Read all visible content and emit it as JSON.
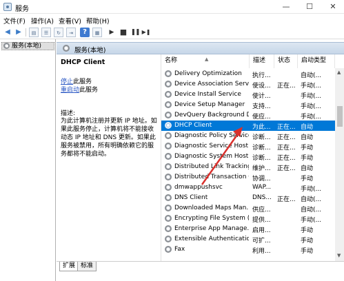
{
  "window": {
    "title": "服务",
    "min": "—",
    "max": "☐",
    "close": "✕"
  },
  "menu": [
    "文件(F)",
    "操作(A)",
    "查看(V)",
    "帮助(H)"
  ],
  "toolbar_icons": [
    "back-icon",
    "forward-icon",
    "console-icon",
    "list-icon",
    "refresh-icon",
    "export-icon",
    "help-icon",
    "properties-icon",
    "play-icon",
    "stop-icon",
    "pause-icon",
    "restart-icon"
  ],
  "tree": {
    "item": "服务(本地)"
  },
  "pane": {
    "header": "服务(本地)"
  },
  "details": {
    "service_name": "DHCP Client",
    "stop_link": "停止",
    "stop_suffix": "此服务",
    "restart_link": "重启动",
    "restart_suffix": "此服务",
    "desc_label": "描述:",
    "description": "为此计算机注册并更新 IP 地址。如果此服务停止，计算机将不能接收动态 IP 地址和 DNS 更新。如果此服务被禁用，所有明确依赖它的服务都将不能启动。"
  },
  "columns": {
    "name": "名称",
    "desc": "描述",
    "status": "状态",
    "startup": "启动类型"
  },
  "services": [
    {
      "name": "Delivery Optimization",
      "desc": "执行...",
      "status": "",
      "startup": "自动(..."
    },
    {
      "name": "Device Association Service",
      "desc": "使设...",
      "status": "正在...",
      "startup": "手动(..."
    },
    {
      "name": "Device Install Service",
      "desc": "使计...",
      "status": "",
      "startup": "手动(..."
    },
    {
      "name": "Device Setup Manager",
      "desc": "支持...",
      "status": "",
      "startup": "手动(..."
    },
    {
      "name": "DevQuery Background D...",
      "desc": "使应...",
      "status": "",
      "startup": "手动(..."
    },
    {
      "name": "DHCP Client",
      "desc": "为此...",
      "status": "正在...",
      "startup": "自动"
    },
    {
      "name": "Diagnostic Policy Service",
      "desc": "诊断...",
      "status": "正在...",
      "startup": "自动"
    },
    {
      "name": "Diagnostic Service Host",
      "desc": "诊断...",
      "status": "正在...",
      "startup": "手动"
    },
    {
      "name": "Diagnostic System Host",
      "desc": "诊断...",
      "status": "正在...",
      "startup": "手动"
    },
    {
      "name": "Distributed Link Tracking...",
      "desc": "维护...",
      "status": "正在...",
      "startup": "自动"
    },
    {
      "name": "Distributed Transaction C...",
      "desc": "协调...",
      "status": "",
      "startup": "手动"
    },
    {
      "name": "dmwappushsvc",
      "desc": "WAP...",
      "status": "",
      "startup": "手动(..."
    },
    {
      "name": "DNS Client",
      "desc": "DNS...",
      "status": "正在...",
      "startup": "自动(..."
    },
    {
      "name": "Downloaded Maps Man...",
      "desc": "供应...",
      "status": "",
      "startup": "自动(..."
    },
    {
      "name": "Encrypting File System (E...",
      "desc": "提供...",
      "status": "",
      "startup": "手动(..."
    },
    {
      "name": "Enterprise App Manage...",
      "desc": "启用...",
      "status": "",
      "startup": "手动"
    },
    {
      "name": "Extensible Authentication...",
      "desc": "可扩...",
      "status": "",
      "startup": "手动"
    },
    {
      "name": "Fax",
      "desc": "利用...",
      "status": "",
      "startup": "手动"
    }
  ],
  "selected_index": 5,
  "tabs": [
    "扩展",
    "标准"
  ],
  "colors": {
    "selection": "#0078d7",
    "link": "#2b58c4",
    "arrow": "#d9302c"
  }
}
